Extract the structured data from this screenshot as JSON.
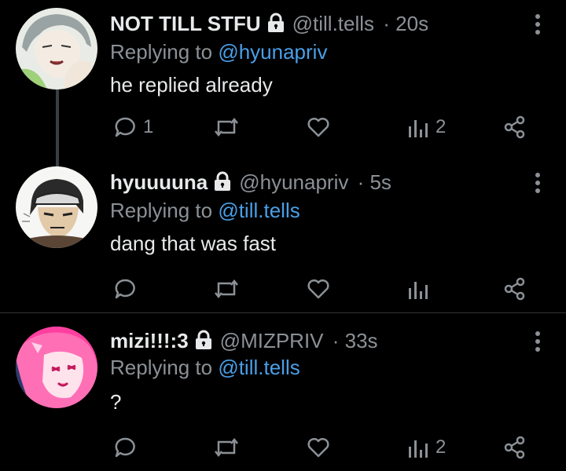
{
  "tweets": [
    {
      "name": "NOT TILL STFU",
      "handle": "@till.tells",
      "dot_time": "· 20s",
      "reply_prefix": "Replying to",
      "reply_target": "@hyunapriv",
      "text": "he replied already",
      "replies": "1",
      "views": "2"
    },
    {
      "name": "hyuuuuna",
      "handle": "@hyunapriv",
      "dot_time": "· 5s",
      "reply_prefix": "Replying to",
      "reply_target": "@till.tells",
      "text": "dang that was fast",
      "replies": "",
      "views": ""
    },
    {
      "name": "mizi!!!:3",
      "handle": "@MIZPRIV",
      "dot_time": "· 33s",
      "reply_prefix": "Replying to",
      "reply_target": "@till.tells",
      "text": "?",
      "replies": "",
      "views": "2"
    }
  ],
  "colors": {
    "background": "#000000",
    "text": "#e7e9ea",
    "muted": "#8b9196",
    "link": "#4a9fe8",
    "thread_line": "#3a3f44"
  }
}
